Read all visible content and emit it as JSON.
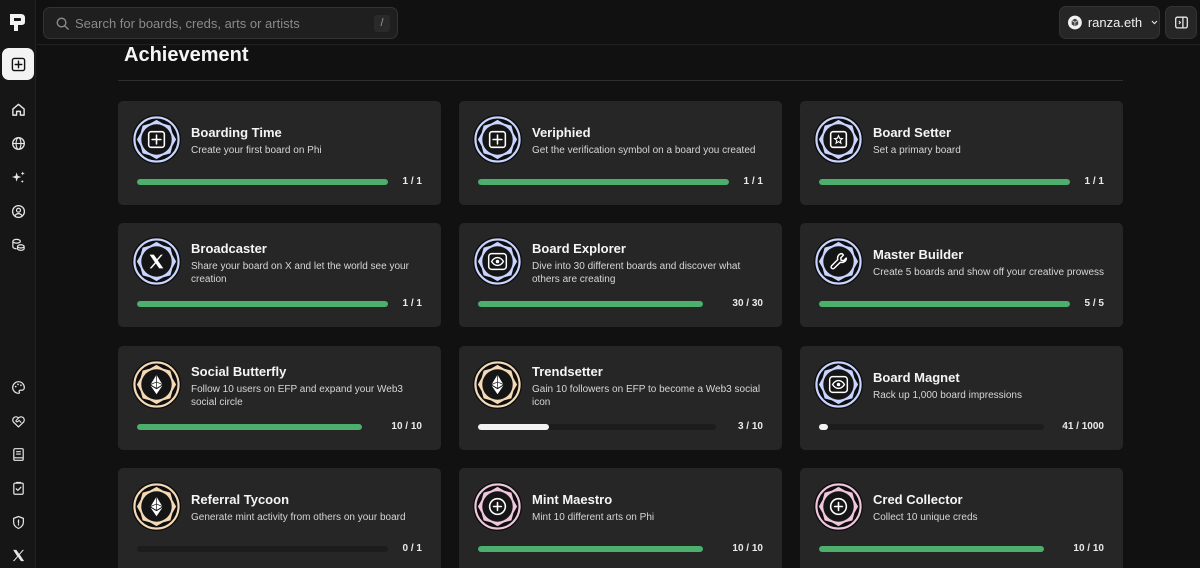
{
  "search": {
    "placeholder": "Search for boards, creds, arts or artists",
    "shortcut": "/"
  },
  "user": {
    "name": "ranza.eth"
  },
  "page": {
    "title": "Achievement"
  },
  "colors": {
    "progress_complete": "#4caf6b",
    "progress_partial": "#f2f2f2",
    "card_bg": "#262626",
    "page_bg": "#111111"
  },
  "sidebar": {
    "items": [
      {
        "icon": "plus-square-icon",
        "active": true
      },
      {
        "icon": "home-icon"
      },
      {
        "icon": "globe-icon"
      },
      {
        "icon": "sparkles-icon"
      },
      {
        "icon": "user-circle-icon"
      },
      {
        "icon": "coins-icon"
      },
      {
        "icon": "palette-icon"
      },
      {
        "icon": "heart-handshake-icon"
      },
      {
        "icon": "book-icon"
      },
      {
        "icon": "clipboard-check-icon"
      },
      {
        "icon": "shield-icon"
      },
      {
        "icon": "x-logo-icon"
      }
    ]
  },
  "achievements": [
    {
      "title": "Boarding Time",
      "desc": "Create your first board on Phi",
      "count": "1 / 1",
      "progress": 1.0,
      "badge": "plus-square-icon"
    },
    {
      "title": "Veriphied",
      "desc": "Get the verification symbol on a board you created",
      "count": "1 / 1",
      "progress": 1.0,
      "badge": "plus-square-icon"
    },
    {
      "title": "Board Setter",
      "desc": "Set a primary board",
      "count": "1 / 1",
      "progress": 1.0,
      "badge": "star-square-icon"
    },
    {
      "title": "Broadcaster",
      "desc": "Share your board on X and let the world see your creation",
      "count": "1 / 1",
      "progress": 1.0,
      "badge": "x-logo-icon"
    },
    {
      "title": "Board Explorer",
      "desc": "Dive into 30 different boards and discover what others are creating",
      "count": "30 / 30",
      "progress": 1.0,
      "badge": "eye-icon"
    },
    {
      "title": "Master Builder",
      "desc": "Create 5 boards and show off your creative prowess",
      "count": "5 / 5",
      "progress": 1.0,
      "badge": "wrench-icon"
    },
    {
      "title": "Social Butterfly",
      "desc": "Follow 10 users on EFP and expand your Web3 social circle",
      "count": "10 / 10",
      "progress": 1.0,
      "badge": "ethereum-icon"
    },
    {
      "title": "Trendsetter",
      "desc": "Gain 10 followers on EFP to become a Web3 social icon",
      "count": "3 / 10",
      "progress": 0.3,
      "badge": "ethereum-icon"
    },
    {
      "title": "Board Magnet",
      "desc": "Rack up 1,000 board impressions",
      "count": "41 / 1000",
      "progress": 0.041,
      "badge": "eye-icon"
    },
    {
      "title": "Referral Tycoon",
      "desc": "Generate mint activity from others on your board",
      "count": "0 / 1",
      "progress": 0.0,
      "badge": "ethereum-icon"
    },
    {
      "title": "Mint Maestro",
      "desc": "Mint 10 different arts on Phi",
      "count": "10 / 10",
      "progress": 1.0,
      "badge": "plus-circle-icon"
    },
    {
      "title": "Cred Collector",
      "desc": "Collect 10 unique creds",
      "count": "10 / 10",
      "progress": 1.0,
      "badge": "plus-circle-icon"
    }
  ]
}
